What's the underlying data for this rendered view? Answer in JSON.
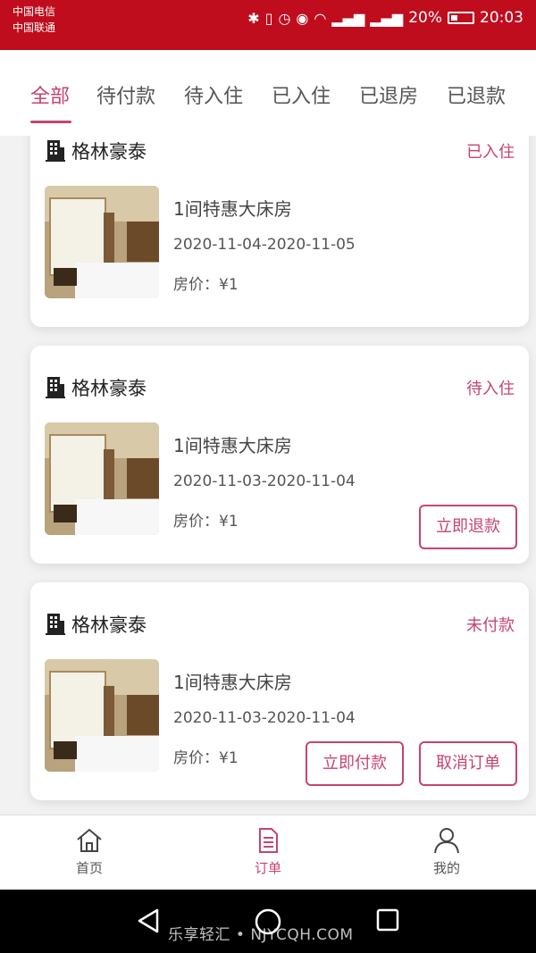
{
  "status_bar": {
    "carrier_1": "中国电信",
    "carrier_2": "中国联通",
    "battery_percent": "20%",
    "time": "20:03",
    "icons": [
      "bluetooth-icon",
      "vibrate-icon",
      "alarm-icon",
      "eye-icon",
      "wifi-icon",
      "signal-2g-icon",
      "signal-4g-icon",
      "battery-icon"
    ]
  },
  "tabs": [
    {
      "label": "全部",
      "active": true
    },
    {
      "label": "待付款",
      "active": false
    },
    {
      "label": "待入住",
      "active": false
    },
    {
      "label": "已入住",
      "active": false
    },
    {
      "label": "已退房",
      "active": false
    },
    {
      "label": "已退款",
      "active": false
    }
  ],
  "orders": [
    {
      "hotel": "格林豪泰",
      "status": "已入住",
      "room": "1间特惠大床房",
      "dates": "2020-11-04-2020-11-05",
      "price": "房价：¥1",
      "buttons": []
    },
    {
      "hotel": "格林豪泰",
      "status": "待入住",
      "room": "1间特惠大床房",
      "dates": "2020-11-03-2020-11-04",
      "price": "房价：¥1",
      "buttons": [
        "立即退款"
      ]
    },
    {
      "hotel": "格林豪泰",
      "status": "未付款",
      "room": "1间特惠大床房",
      "dates": "2020-11-03-2020-11-04",
      "price": "房价：¥1",
      "buttons": [
        "立即付款",
        "取消订单"
      ]
    }
  ],
  "bottom_nav": [
    {
      "label": "首页",
      "icon": "home-icon",
      "active": false
    },
    {
      "label": "订单",
      "icon": "order-document-icon",
      "active": true
    },
    {
      "label": "我的",
      "icon": "profile-icon",
      "active": false
    }
  ],
  "watermark": "乐享轻汇 • NJYCQH.COM",
  "colors": {
    "status_bar": "#c00d1e",
    "accent": "#c74372"
  }
}
